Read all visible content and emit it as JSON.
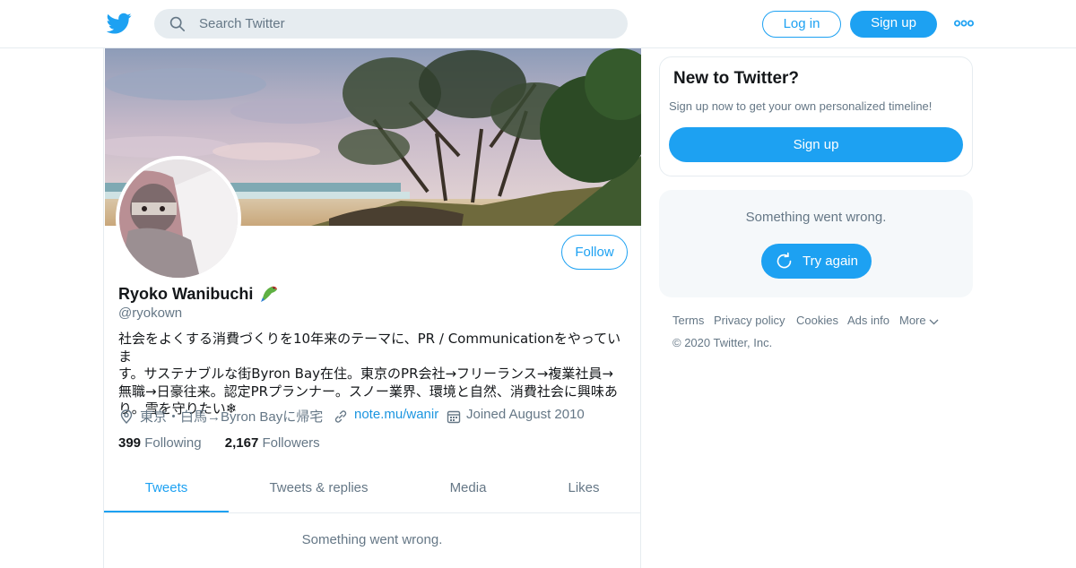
{
  "header": {
    "search_placeholder": "Search Twitter",
    "login_label": "Log in",
    "signup_label": "Sign up",
    "logo_icon": "twitter-bird-icon",
    "more_icon": "more-dots-icon"
  },
  "profile": {
    "name": "Ryoko Wanibuchi",
    "name_emoji_icon": "parrot-icon",
    "handle": "@ryokown",
    "follow_label": "Follow",
    "bio_lines": [
      "社会をよくする消費づくりを10年来のテーマに、PR / Communicationをやっていま",
      "す。サステナブルな街Byron Bay在住。東京のPR会社→フリーランス→複業社員→",
      "無職→日豪往来。認定PRプランナー。スノー業界、環境と自然、消費社会に興味あ",
      "り。雪を守りたい❄"
    ],
    "location": "東京・白馬→Byron Bayに帰宅",
    "website": "note.mu/wanir",
    "joined": "Joined August 2010",
    "following_count": "399",
    "following_label": "Following",
    "followers_count": "2,167",
    "followers_label": "Followers"
  },
  "tabs": [
    "Tweets",
    "Tweets & replies",
    "Media",
    "Likes"
  ],
  "main_error": "Something went wrong.",
  "sidebar": {
    "new_title": "New to Twitter?",
    "new_text": "Sign up now to get your own personalized timeline!",
    "signup_label": "Sign up",
    "error_text": "Something went wrong.",
    "try_again_label": "Try again"
  },
  "footer": {
    "links": [
      "Terms",
      "Privacy policy",
      "Cookies",
      "Ads info",
      "More"
    ],
    "copyright": "© 2020 Twitter, Inc."
  },
  "colors": {
    "accent": "#1da1f2",
    "secondary_text": "#657786",
    "border": "#e6ecf0"
  }
}
